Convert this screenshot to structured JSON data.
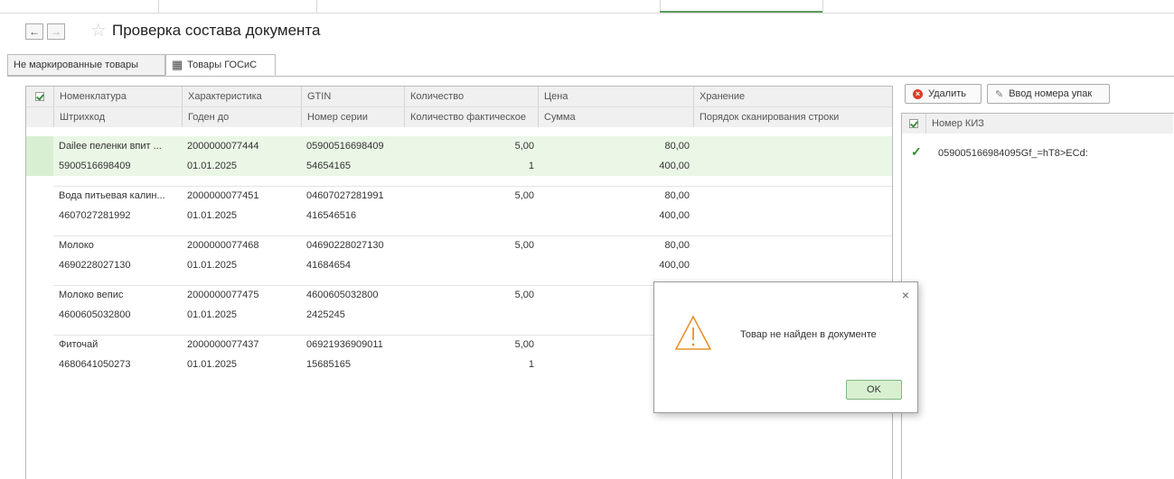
{
  "window": {
    "title": "Проверка состава документа",
    "back_icon": "←",
    "forward_icon": "→",
    "star_icon": "☆"
  },
  "tabs": [
    {
      "label": "Не маркированные товары"
    },
    {
      "label": "Товары ГОСиС",
      "icon": "▦"
    }
  ],
  "table": {
    "headers_row1": [
      "Номенклатура",
      "Характеристика",
      "GTIN",
      "Количество",
      "Цена",
      "Хранение"
    ],
    "headers_row2": [
      "Штрихкод",
      "Годен до",
      "Номер серии",
      "Количество фактическое",
      "Сумма",
      "Порядок сканирования строки"
    ],
    "rows": [
      {
        "name": "Dailee пеленки впит ...",
        "barcode": "5900516698409",
        "characteristic": "2000000077444",
        "expiry": "01.01.2025",
        "gtin": "05900516698409",
        "series": "54654165",
        "qty": "5,00",
        "qty_fact": "1",
        "price": "80,00",
        "sum": "400,00"
      },
      {
        "name": "Вода питьевая калин...",
        "barcode": "4607027281992",
        "characteristic": "2000000077451",
        "expiry": "01.01.2025",
        "gtin": "04607027281991",
        "series": "416546516",
        "qty": "5,00",
        "qty_fact": "",
        "price": "80,00",
        "sum": "400,00"
      },
      {
        "name": "Молоко",
        "barcode": "4690228027130",
        "characteristic": "2000000077468",
        "expiry": "01.01.2025",
        "gtin": "04690228027130",
        "series": "41684654",
        "qty": "5,00",
        "qty_fact": "",
        "price": "80,00",
        "sum": "400,00"
      },
      {
        "name": "Молоко вепис",
        "barcode": "4600605032800",
        "characteristic": "2000000077475",
        "expiry": "01.01.2025",
        "gtin": "4600605032800",
        "series": "2425245",
        "qty": "5,00",
        "qty_fact": "",
        "price": "",
        "sum": ""
      },
      {
        "name": "Фиточай",
        "barcode": "4680641050273",
        "characteristic": "2000000077437",
        "expiry": "01.01.2025",
        "gtin": "06921936909011",
        "series": "15685165",
        "qty": "5,00",
        "qty_fact": "1",
        "price": "",
        "sum": ""
      }
    ]
  },
  "right_panel": {
    "delete_label": "Удалить",
    "delete_icon": "×",
    "input_pack_label": "Ввод номера упак",
    "pencil_icon": "✎",
    "kiz_header": "Номер КИЗ",
    "kiz_items": [
      {
        "value": "059005166984095Gf_=hT8>ECd:",
        "check": "✓"
      }
    ]
  },
  "dialog": {
    "message": "Товар не найден в документе",
    "ok_label": "OK",
    "close_icon": "×"
  },
  "colors": {
    "selected_row": "#eaf6e6",
    "warning": "#e8912d",
    "delete": "#e03b2a",
    "ok_button": "#d8f0d0"
  }
}
